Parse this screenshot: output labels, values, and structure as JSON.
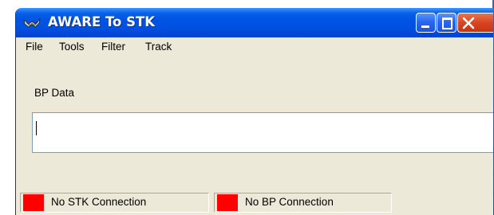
{
  "window": {
    "title": "AWARE To STK",
    "icon": "aware-app-icon"
  },
  "titlebar_buttons": {
    "minimize": "minimize-icon",
    "maximize": "maximize-icon",
    "close": "close-icon"
  },
  "menu": {
    "items": [
      "File",
      "Tools",
      "Filter",
      "Track"
    ]
  },
  "bp_data": {
    "label": "BP Data",
    "value": ""
  },
  "status": {
    "stk": {
      "text": "No STK Connection",
      "indicator_color": "#ff0000"
    },
    "bp": {
      "text": "No BP Connection",
      "indicator_color": "#ff0000"
    }
  },
  "colors": {
    "titlebar": "#0054e3",
    "window_face": "#ece9d8",
    "close_button": "#d8461f"
  }
}
